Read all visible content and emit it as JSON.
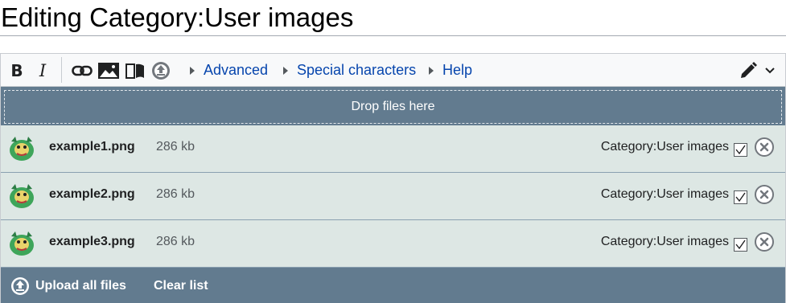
{
  "page": {
    "title": "Editing Category:User images"
  },
  "toolbar": {
    "bold_label": "B",
    "italic_label": "I",
    "advanced_label": "Advanced",
    "special_label": "Special characters",
    "help_label": "Help",
    "icons": [
      "link-icon",
      "image-icon",
      "book-icon",
      "upload-icon",
      "pencil-icon",
      "chevron-down-icon"
    ]
  },
  "dropzone": {
    "label": "Drop files here"
  },
  "files": [
    {
      "name": "example1.png",
      "size": "286 kb",
      "category": "Category:User images",
      "checked": true
    },
    {
      "name": "example2.png",
      "size": "286 kb",
      "category": "Category:User images",
      "checked": true
    },
    {
      "name": "example3.png",
      "size": "286 kb",
      "category": "Category:User images",
      "checked": true
    }
  ],
  "footer": {
    "upload_label": "Upload all files",
    "clear_label": "Clear list"
  },
  "colors": {
    "link": "#0645ad",
    "bar": "#627b8f",
    "row": "#dde7e4"
  }
}
